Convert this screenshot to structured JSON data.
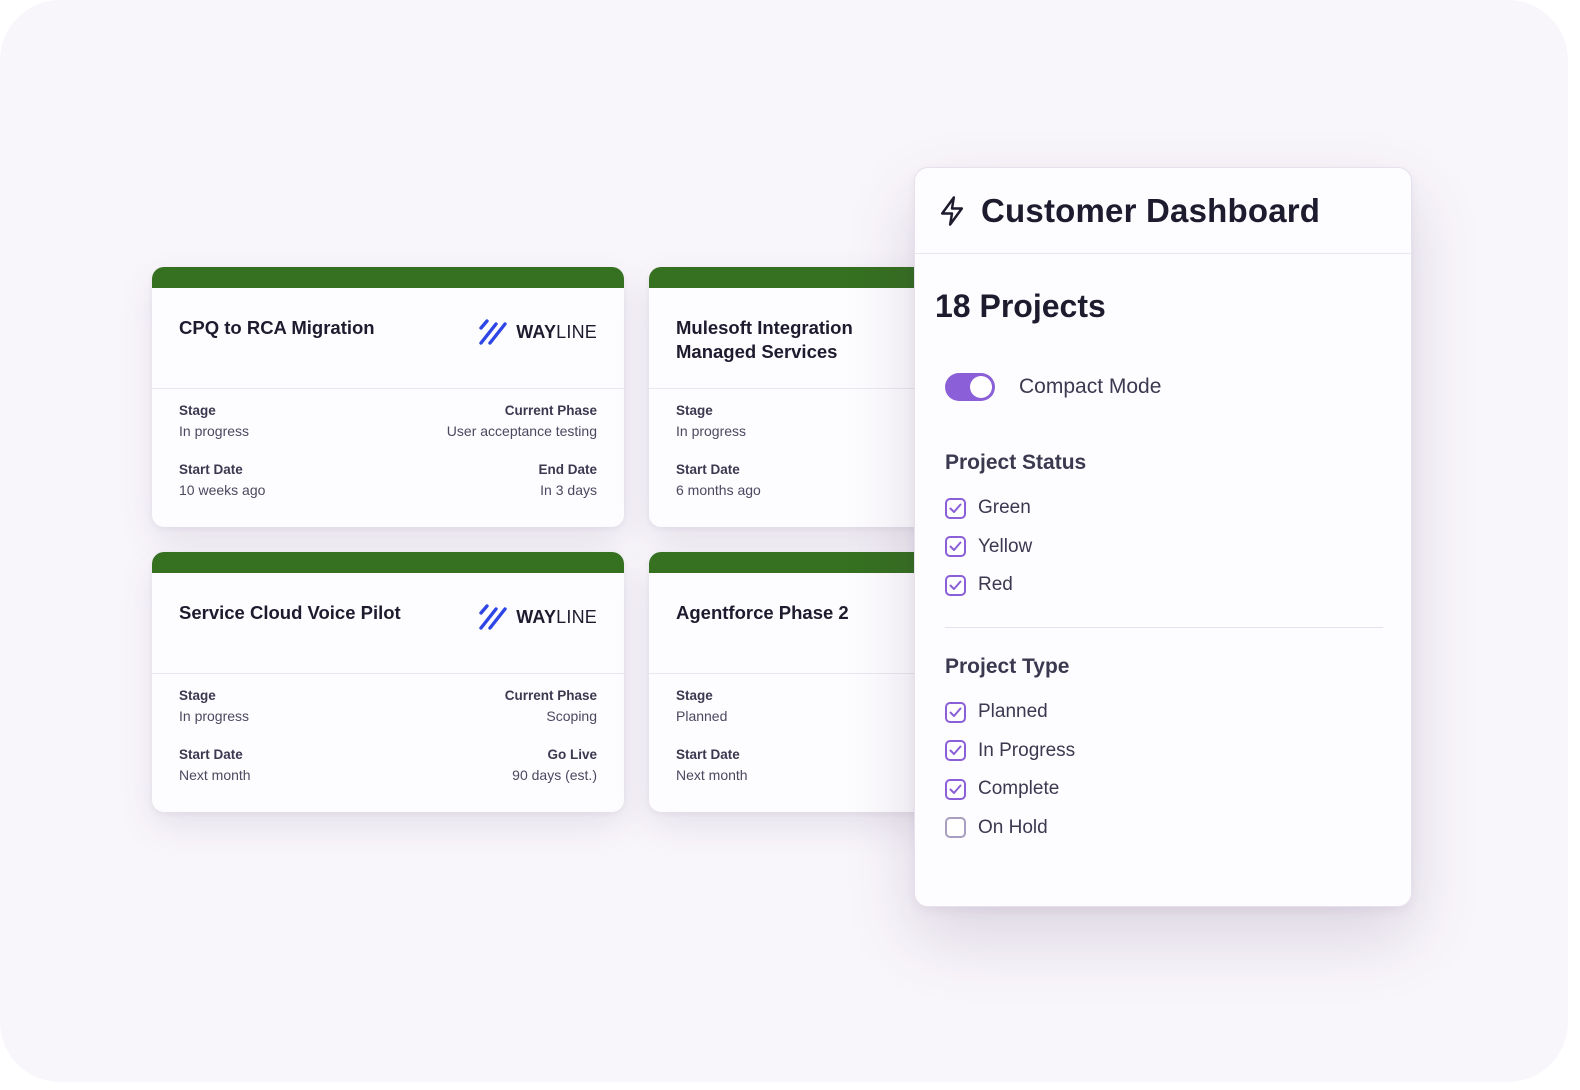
{
  "colors": {
    "card_bar": "#367021",
    "accent": "#8a5fd8",
    "logo_blue": "#2e46e6"
  },
  "cards": [
    {
      "title": "CPQ to RCA Migration",
      "logo": {
        "bold": "WAY",
        "light": "LINE",
        "icon": "wayline-logo-icon"
      },
      "fields": [
        {
          "label": "Stage",
          "value": "In progress"
        },
        {
          "label": "Current Phase",
          "value": "User acceptance testing"
        },
        {
          "label": "Start Date",
          "value": "10 weeks ago"
        },
        {
          "label": "End Date",
          "value": "In 3 days"
        }
      ]
    },
    {
      "title": "Mulesoft Integration Managed Services",
      "fields": [
        {
          "label": "Stage",
          "value": "In progress"
        },
        {
          "label": "Start Date",
          "value": "6 months ago"
        }
      ]
    },
    {
      "title": "Service Cloud Voice Pilot",
      "logo": {
        "bold": "WAY",
        "light": "LINE",
        "icon": "wayline-logo-icon"
      },
      "fields": [
        {
          "label": "Stage",
          "value": "In progress"
        },
        {
          "label": "Current Phase",
          "value": "Scoping"
        },
        {
          "label": "Start Date",
          "value": "Next month"
        },
        {
          "label": "Go Live",
          "value": "90 days (est.)"
        }
      ]
    },
    {
      "title": "Agentforce Phase 2",
      "fields": [
        {
          "label": "Stage",
          "value": "Planned"
        },
        {
          "label": "Start Date",
          "value": "Next month"
        }
      ]
    }
  ],
  "panel": {
    "icon": "lightning-icon",
    "title": "Customer Dashboard",
    "count": "18 Projects",
    "compact_mode": {
      "label": "Compact Mode",
      "on": true
    },
    "status": {
      "title": "Project Status",
      "options": [
        {
          "label": "Green",
          "checked": true
        },
        {
          "label": "Yellow",
          "checked": true
        },
        {
          "label": "Red",
          "checked": true
        }
      ]
    },
    "type": {
      "title": "Project Type",
      "options": [
        {
          "label": "Planned",
          "checked": true
        },
        {
          "label": "In Progress",
          "checked": true
        },
        {
          "label": "Complete",
          "checked": true
        },
        {
          "label": "On Hold",
          "checked": false
        }
      ]
    }
  }
}
